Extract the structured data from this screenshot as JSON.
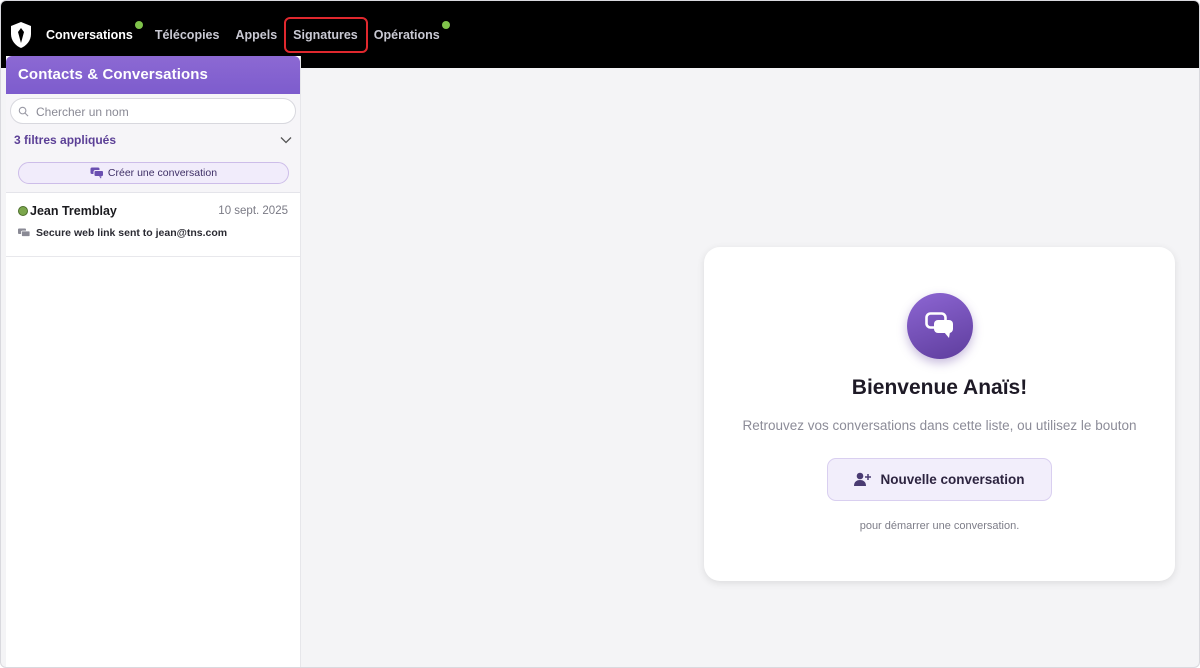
{
  "nav": {
    "items": [
      {
        "label": "Conversations",
        "active": true,
        "dot": true
      },
      {
        "label": "Télécopies",
        "active": false,
        "dot": false
      },
      {
        "label": "Appels",
        "active": false,
        "dot": false
      },
      {
        "label": "Signatures",
        "active": false,
        "dot": false,
        "highlighted": true
      },
      {
        "label": "Opérations",
        "active": false,
        "dot": true
      }
    ]
  },
  "sidebar": {
    "title": "Contacts & Conversations",
    "search_placeholder": "Chercher un nom",
    "filters_label": "3 filtres appliqués",
    "create_label": "Créer une conversation",
    "conversations": [
      {
        "name": "Jean Tremblay",
        "date": "10 sept. 2025",
        "preview": "Secure web link sent to jean@tns.com"
      }
    ]
  },
  "welcome": {
    "title": "Bienvenue Anaïs!",
    "subtitle": "Retrouvez vos conversations dans cette liste, ou utilisez le bouton",
    "button_label": "Nouvelle conversation",
    "footer": "pour démarrer une conversation."
  },
  "colors": {
    "accent": "#7d5ccd",
    "status_online": "#7ba64c",
    "highlight": "#e0282e"
  }
}
